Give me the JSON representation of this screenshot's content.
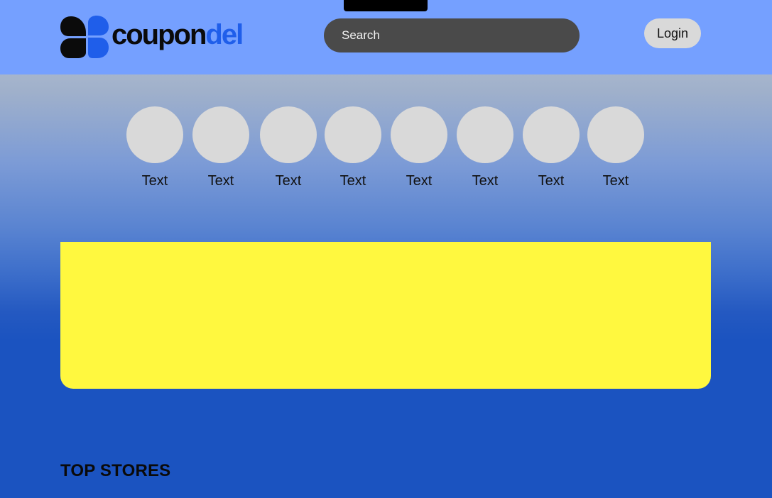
{
  "brand": {
    "name_part1": "coupon",
    "name_part2": "del",
    "primary_color": "#1f5eea",
    "dark_color": "#0b0b0b"
  },
  "header": {
    "background": "#75a0ff",
    "search": {
      "placeholder": "Search"
    },
    "login_label": "Login"
  },
  "categories": [
    {
      "label": "Text"
    },
    {
      "label": "Text"
    },
    {
      "label": "Text"
    },
    {
      "label": "Text"
    },
    {
      "label": "Text"
    },
    {
      "label": "Text"
    },
    {
      "label": "Text"
    },
    {
      "label": "Text"
    }
  ],
  "banner": {
    "color": "#fff83f"
  },
  "sections": {
    "top_stores_title": "TOP STORES"
  }
}
